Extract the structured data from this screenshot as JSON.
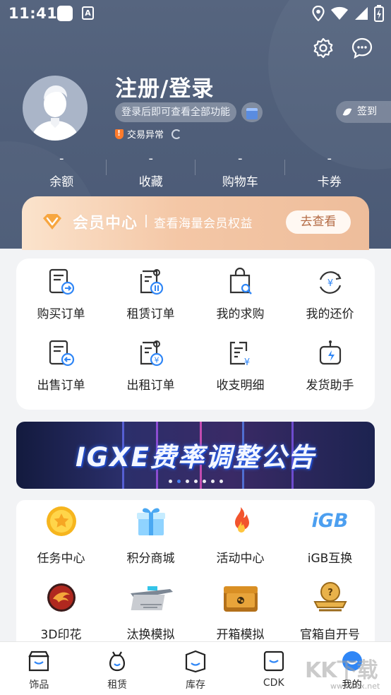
{
  "status_bar": {
    "time": "11:41",
    "a_icon": "A"
  },
  "profile": {
    "login_title": "注册/登录",
    "login_hint": "登录后即可查看全部功能",
    "trade_status": "交易异常",
    "sign_in": "签到"
  },
  "stats": [
    {
      "value": "-",
      "label": "余额"
    },
    {
      "value": "-",
      "label": "收藏"
    },
    {
      "value": "-",
      "label": "购物车"
    },
    {
      "value": "-",
      "label": "卡券"
    }
  ],
  "vip": {
    "title": "会员中心",
    "subtitle": "查看海量会员权益",
    "button": "去查看"
  },
  "orders": [
    {
      "label": "购买订单",
      "icon": "buy-order-icon"
    },
    {
      "label": "租赁订单",
      "icon": "lease-order-icon"
    },
    {
      "label": "我的求购",
      "icon": "my-request-icon"
    },
    {
      "label": "我的还价",
      "icon": "counter-offer-icon"
    },
    {
      "label": "出售订单",
      "icon": "sell-order-icon"
    },
    {
      "label": "出租订单",
      "icon": "rent-out-order-icon"
    },
    {
      "label": "收支明细",
      "icon": "income-expense-icon"
    },
    {
      "label": "发货助手",
      "icon": "delivery-assistant-icon"
    }
  ],
  "banner": {
    "text": "IGXE费率调整公告",
    "dots": 7,
    "active_dot": 2
  },
  "tools": [
    {
      "label": "任务中心",
      "icon": "task-coin-icon"
    },
    {
      "label": "积分商城",
      "icon": "gift-box-icon"
    },
    {
      "label": "活动中心",
      "icon": "fire-icon"
    },
    {
      "label": "iGB互换",
      "icon": "igb-logo-icon",
      "logo_text": "iGB"
    },
    {
      "label": "3D印花",
      "icon": "sticker-icon"
    },
    {
      "label": "汰换模拟",
      "icon": "rifle-icon"
    },
    {
      "label": "开箱模拟",
      "icon": "case-icon"
    },
    {
      "label": "官箱自开号",
      "icon": "cs-badge-icon"
    }
  ],
  "tabbar": [
    {
      "label": "饰品",
      "icon": "shop-icon"
    },
    {
      "label": "租赁",
      "icon": "bag-icon"
    },
    {
      "label": "库存",
      "icon": "inventory-icon"
    },
    {
      "label": "CDK",
      "icon": "cdk-icon"
    },
    {
      "label": "我的",
      "icon": "me-icon",
      "active": true
    }
  ],
  "colors": {
    "header": "#56657f",
    "accent_blue": "#2f86f6",
    "vip_gold": "#f4c7a6"
  },
  "watermark": {
    "main": "KK下载",
    "sub": "www.kkx.net"
  }
}
